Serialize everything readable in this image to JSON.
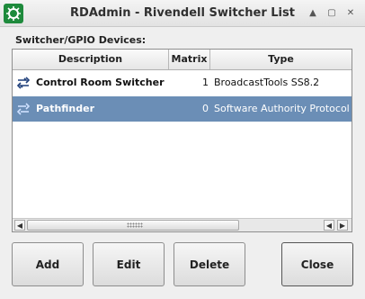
{
  "window": {
    "title": "RDAdmin - Rivendell Switcher List",
    "controls": {
      "up": "▲",
      "maximize": "▢",
      "close": "✕"
    }
  },
  "devices_label": "Switcher/GPIO Devices:",
  "table": {
    "columns": {
      "description": "Description",
      "matrix": "Matrix",
      "type": "Type"
    },
    "rows": [
      {
        "description": "Control Room Switcher",
        "matrix": "1",
        "type": "BroadcastTools SS8.2",
        "selected": false
      },
      {
        "description": "Pathfinder",
        "matrix": "0",
        "type": "Software Authority Protocol",
        "selected": true
      }
    ],
    "row_icon": "switcher-arrows-icon"
  },
  "scrollbar": {
    "left": "◀",
    "right1": "◀",
    "right2": "▶"
  },
  "buttons": {
    "add": "Add",
    "edit": "Edit",
    "delete": "Delete",
    "close": "Close"
  },
  "colors": {
    "selection": "#6b8eb6",
    "app_icon": "#1e8a3c"
  }
}
